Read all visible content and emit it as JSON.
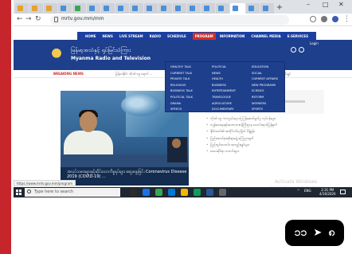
{
  "colors": {
    "accent_red": "#c6252b",
    "site_blue": "#1e3f8c",
    "nav_blue": "#1b3fa0",
    "highlight_red": "#d12c2c",
    "taskbar": "#1f2733",
    "badge": "#000000"
  },
  "browser": {
    "tab_favicon_colors": [
      "#e5a22c",
      "#e5a22c",
      "#e5a22c",
      "#4a90d9",
      "#3aa757",
      "#4a90d9",
      "#4a90d9",
      "#4a90d9",
      "#4a90d9",
      "#4a90d9",
      "#4a90d9",
      "#4a90d9",
      "#4a90d9",
      "#4a90d9",
      "#4a90d9",
      "#4a90d9",
      "#4a90d9",
      "#4a90d9"
    ],
    "new_tab_label": "+",
    "window_controls": [
      "–",
      "□",
      "✕"
    ],
    "url": "mrtv.gov.mm/mm"
  },
  "site": {
    "nav_items": [
      "HOME",
      "NEWS",
      "LIVE STREAM",
      "RADIO",
      "SCHEDULE",
      "PROGRAM",
      "INFORMATION",
      "CHANNEL MEDIA",
      "E-SERVICES"
    ],
    "nav_active": "PROGRAM",
    "title_my": "မြန်မာ့အသံနှင့် ရုပ်မြင်သံကြား",
    "title_en": "Myanma Radio and Television",
    "login_label": "Login",
    "breaking_label": "BREAKING NEWS",
    "breaking_text": "မြန်မာနိုင်ငံ ကိုဗစ်-၁၉ ရောဂါ ...",
    "breaking_text_right": "... အတိုချုပ်"
  },
  "dropdown": {
    "col1": [
      "HEALTHY TALK",
      "CURRENT TALK",
      "PRIVATE TALK",
      "RELIGIOUS",
      "BUSINESS TALK",
      "POLITICAL TALK",
      "DRAMA",
      "SPEECH"
    ],
    "col2": [
      "POLITICAL",
      "NEWS",
      "HEALTH",
      "BUSINESS",
      "ENTERTAINMENT",
      "TRAVELOGUE",
      "AGRICULTURE",
      "DOCUMENTARY"
    ],
    "col3": [
      "EDUCATION",
      "SOCIAL",
      "CURRENT AFFAIRS",
      "NEW PROGRAMS",
      "SCIENCE",
      "REFORM",
      "WORKERS",
      "SPORTS"
    ]
  },
  "video": {
    "caption": "အလုပ်သမားများနှင့်ဆိုင်သောကိစ္စရပ်များ ဆွေးနွေးခြင်း Coronavirus Disease 2019 (COVID-19) ..."
  },
  "news": {
    "items": [
      "ကိုဗစ်-၁၉ ကာကွယ်ရေး တုံ့ပြန်ဆောင်ရွက်မှု လုပ်ငန်းများ",
      "ကျန်းမာရေးနှင့်အားကစားဝန်ကြီးဌာန သတင်းထုတ်ပြန်ချက်",
      "နိုင်ငံတော်၏ အတိုင်ပင်ခံပုဂ္ဂိုလ် မိန့်ခွန်း",
      "ပြည်ထောင်စုအစိုးရအဖွဲ့ ကြေညာချက်",
      "ပြည်တွင်းသတင်း အကျဉ်းချုပ်များ",
      "ဒေသဆိုင်ရာ သတင်းများ"
    ]
  },
  "overlay": {
    "watermark_title": "Activate Windows",
    "watermark_sub": "Go to Settings to activate Windows.",
    "status_url": "https://www.mrtv.gov.mm/program"
  },
  "taskbar": {
    "search_placeholder": "Type here to search",
    "tray_items": [
      "^",
      "ENG"
    ],
    "time": "2:31 PM",
    "date": "4/16/2020",
    "app_colors": [
      "#2b2b2b",
      "#1a73e8",
      "#34a853",
      "#0078d7",
      "#f7b500",
      "#0f9d58",
      "#2b5797",
      "#666666"
    ]
  },
  "pagination": {
    "current": "၁၁",
    "arrow": "➤",
    "next": "၈"
  }
}
